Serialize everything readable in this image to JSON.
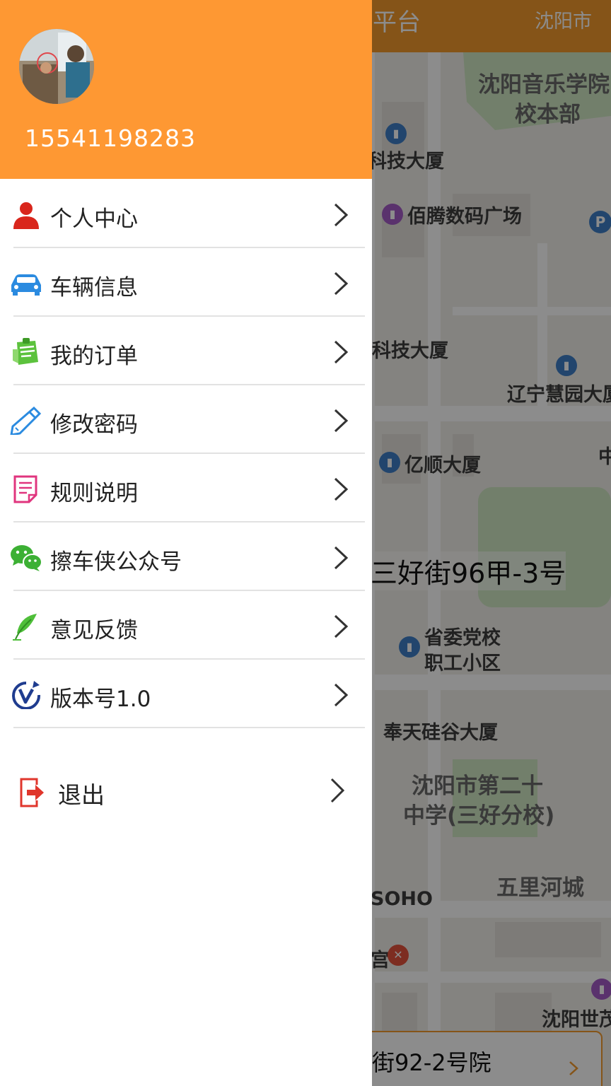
{
  "app": {
    "title_partial": "平台",
    "city": "沈阳市"
  },
  "map": {
    "labels": {
      "music_school_1": "沈阳音乐学院",
      "music_school_2": "校本部",
      "tech_building_1": "科技大厦",
      "baiteng": "佰腾数码广场",
      "tech_building_2": "科技大厦",
      "huiyuan": "辽宁慧园大厦",
      "yishun": "亿顺大厦",
      "zhong": "中",
      "party_school_1": "省委党校",
      "party_school_2": "职工小区",
      "fengtian": "奉天硅谷大厦",
      "middle_school_1": "沈阳市第二十",
      "middle_school_2": "中学(三好分校)",
      "wulihe": "五里河城",
      "soho": "SOHO",
      "gong": "宫",
      "shenyang_shi": "沈阳世茂"
    },
    "current_address": "三好街96甲-3号",
    "bottom_address": "街92-2号院",
    "parking_icon": "P"
  },
  "drawer": {
    "phone": "15541198283",
    "avatar_icon": "avatar-photo",
    "menu": [
      {
        "label": "个人中心",
        "icon": "person-icon"
      },
      {
        "label": "车辆信息",
        "icon": "car-icon"
      },
      {
        "label": "我的订单",
        "icon": "order-icon"
      },
      {
        "label": "修改密码",
        "icon": "pencil-icon"
      },
      {
        "label": "规则说明",
        "icon": "document-icon"
      },
      {
        "label": "擦车侠公众号",
        "icon": "wechat-icon"
      },
      {
        "label": "意见反馈",
        "icon": "feather-icon"
      },
      {
        "label": "版本号1.0",
        "icon": "version-icon"
      }
    ],
    "logout_label": "退出"
  },
  "colors": {
    "accent": "#fe9833",
    "divider": "#e2e2e2"
  }
}
